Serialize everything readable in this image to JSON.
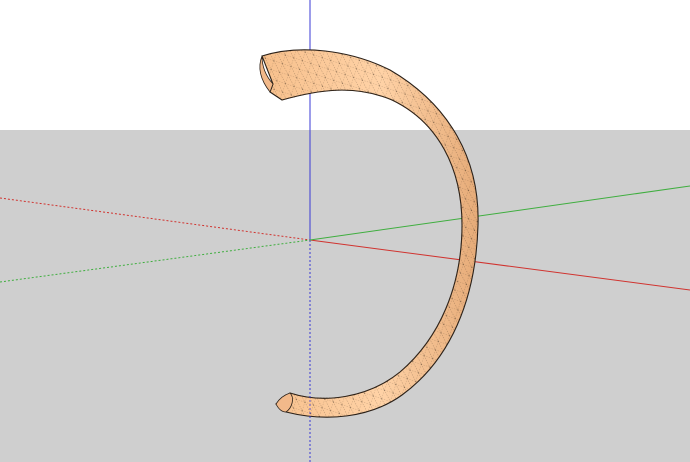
{
  "scene": {
    "sky_color": "#ffffff",
    "ground_color": "#cfcfcf",
    "model_fill_color": "#fbc99a",
    "model_shade_color": "#e8ae7b",
    "model_edge_color": "#2a2018",
    "axes": {
      "red_color": "#d0332f",
      "green_color": "#3fae3f",
      "blue_color": "#3a3ad6"
    }
  }
}
